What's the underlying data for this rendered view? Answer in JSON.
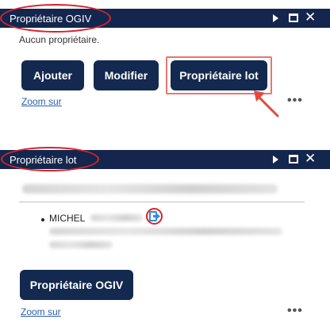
{
  "panel1": {
    "title": "Propriétaire OGIV",
    "status": "Aucun propriétaire.",
    "buttons": {
      "add": "Ajouter",
      "edit": "Modifier",
      "lot": "Propriétaire lot"
    },
    "zoom_link": "Zoom sur",
    "more": "•••"
  },
  "panel2": {
    "title": "Propriétaire lot",
    "owner_name": "MICHEL",
    "button_ogiv": "Propriétaire OGIV",
    "zoom_link": "Zoom sur",
    "more": "•••"
  },
  "header_controls": {
    "close_glyph": "✕"
  },
  "colors": {
    "header_bg": "#14264d",
    "button_bg": "#13294f",
    "annotation_red": "#d8232a",
    "highlight_box": "#e8766d",
    "link": "#2c5fa8",
    "exit_icon": "#2f8fdc"
  },
  "icons": [
    "play-icon",
    "maximize-icon",
    "close-icon",
    "exit-icon",
    "arrow-annotation-icon",
    "more-icon"
  ]
}
